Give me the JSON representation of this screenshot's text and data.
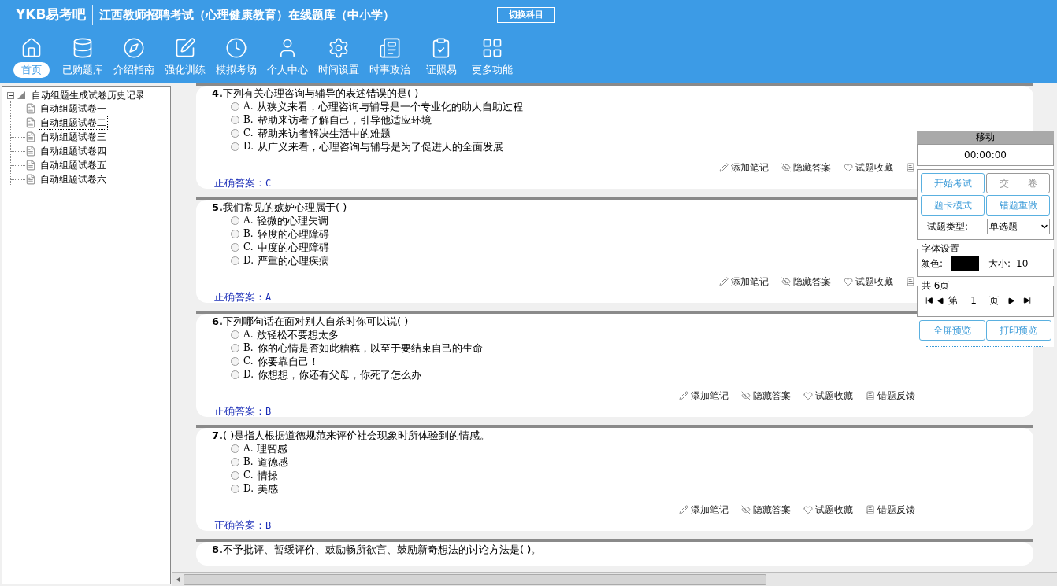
{
  "header": {
    "logo": "YKB易考吧",
    "title": "江西教师招聘考试（心理健康教育）在线题库（中小学）",
    "switch_button": "切换科目"
  },
  "nav": [
    {
      "kind": "home",
      "label": "首页",
      "selected": true
    },
    {
      "kind": "database",
      "label": "已购题库",
      "selected": false
    },
    {
      "kind": "compass",
      "label": "介绍指南",
      "selected": false
    },
    {
      "kind": "edit",
      "label": "强化训练",
      "selected": false
    },
    {
      "kind": "clock",
      "label": "模拟考场",
      "selected": false
    },
    {
      "kind": "user",
      "label": "个人中心",
      "selected": false
    },
    {
      "kind": "gear",
      "label": "时间设置",
      "selected": false
    },
    {
      "kind": "news",
      "label": "时事政治",
      "selected": false
    },
    {
      "kind": "checklist",
      "label": "证照易",
      "selected": false
    },
    {
      "kind": "grid",
      "label": "更多功能",
      "selected": false
    }
  ],
  "tree": {
    "label": "自动组题生成试卷历史记录",
    "expanded": true,
    "children": [
      {
        "label": "自动组题试卷一",
        "selected": false
      },
      {
        "label": "自动组题试卷二",
        "selected": true
      },
      {
        "label": "自动组题试卷三",
        "selected": false
      },
      {
        "label": "自动组题试卷四",
        "selected": false
      },
      {
        "label": "自动组题试卷五",
        "selected": false
      },
      {
        "label": "自动组题试卷六",
        "selected": false
      }
    ]
  },
  "questions": [
    {
      "number": "4.",
      "text": "下列有关心理咨询与辅导的表述错误的是( )",
      "options": [
        {
          "letter": "A.",
          "text": "从狭义来看，心理咨询与辅导是一个专业化的助人自助过程",
          "selected": false
        },
        {
          "letter": "B.",
          "text": "帮助来访者了解自己，引导他适应环境",
          "selected": false
        },
        {
          "letter": "C.",
          "text": "帮助来访者解决生活中的难题",
          "selected": false
        },
        {
          "letter": "D.",
          "text": "从广义来看，心理咨询与辅导是为了促进人的全面发展",
          "selected": false
        }
      ],
      "actions": [
        {
          "kind": "note",
          "label": "添加笔记"
        },
        {
          "kind": "hide",
          "label": "隐藏答案"
        },
        {
          "kind": "favorite",
          "label": "试题收藏"
        },
        {
          "kind": "feedback"
        }
      ],
      "answer_label": "正确答案：",
      "answer": "C"
    },
    {
      "number": "5.",
      "text": "我们常见的嫉妒心理属于( )",
      "options": [
        {
          "letter": "A.",
          "text": "轻微的心理失调",
          "selected": false
        },
        {
          "letter": "B.",
          "text": "轻度的心理障碍",
          "selected": false
        },
        {
          "letter": "C.",
          "text": "中度的心理障碍",
          "selected": false
        },
        {
          "letter": "D.",
          "text": "严重的心理疾病",
          "selected": false
        }
      ],
      "actions": [
        {
          "kind": "note",
          "label": "添加笔记"
        },
        {
          "kind": "hide",
          "label": "隐藏答案"
        },
        {
          "kind": "favorite",
          "label": "试题收藏"
        },
        {
          "kind": "feedback"
        }
      ],
      "answer_label": "正确答案：",
      "answer": "A"
    },
    {
      "number": "6.",
      "text": "下列哪句话在面对别人自杀时你可以说( )",
      "options": [
        {
          "letter": "A.",
          "text": "放轻松不要想太多",
          "selected": false
        },
        {
          "letter": "B.",
          "text": "你的心情是否如此糟糕，以至于要结束自己的生命",
          "selected": false
        },
        {
          "letter": "C.",
          "text": "你要靠自己！",
          "selected": false
        },
        {
          "letter": "D.",
          "text": "你想想，你还有父母，你死了怎么办",
          "selected": false
        }
      ],
      "actions": [
        {
          "kind": "note",
          "label": "添加笔记"
        },
        {
          "kind": "hide",
          "label": "隐藏答案"
        },
        {
          "kind": "favorite",
          "label": "试题收藏"
        },
        {
          "kind": "feedback",
          "label": "错题反馈"
        }
      ],
      "answer_label": "正确答案：",
      "answer": "B"
    },
    {
      "number": "7.",
      "text": "( )是指人根据道德规范来评价社会现象时所体验到的情感。",
      "options": [
        {
          "letter": "A.",
          "text": "理智感",
          "selected": false
        },
        {
          "letter": "B.",
          "text": "道德感",
          "selected": false
        },
        {
          "letter": "C.",
          "text": "情操",
          "selected": false
        },
        {
          "letter": "D.",
          "text": "美感",
          "selected": false
        }
      ],
      "actions": [
        {
          "kind": "note",
          "label": "添加笔记"
        },
        {
          "kind": "hide",
          "label": "隐藏答案"
        },
        {
          "kind": "favorite",
          "label": "试题收藏"
        },
        {
          "kind": "feedback",
          "label": "错题反馈"
        }
      ],
      "answer_label": "正确答案：",
      "answer": "B"
    },
    {
      "number": "8.",
      "text": "不予批评、暂缓评价、鼓励畅所欲言、鼓励新奇想法的讨论方法是( )。"
    }
  ],
  "panel": {
    "title": "移动",
    "timer": "00:00:00",
    "buttons": [
      {
        "label": "开始考试",
        "disabled": false
      },
      {
        "label": "交　　卷",
        "disabled": true
      },
      {
        "label": "题卡模式",
        "disabled": false
      },
      {
        "label": "错题重做",
        "disabled": false
      }
    ],
    "type_label": "试题类型:",
    "type_value": "单选题",
    "font_group": "字体设置",
    "color_label": "颜色:",
    "color": "#000000",
    "size_label": "大小:",
    "size_value": "10",
    "pages_group": "共 6页",
    "page_prefix": "第",
    "page_value": "1",
    "page_suffix": "页",
    "bottom_buttons": [
      "全屏预览",
      "打印预览"
    ]
  }
}
